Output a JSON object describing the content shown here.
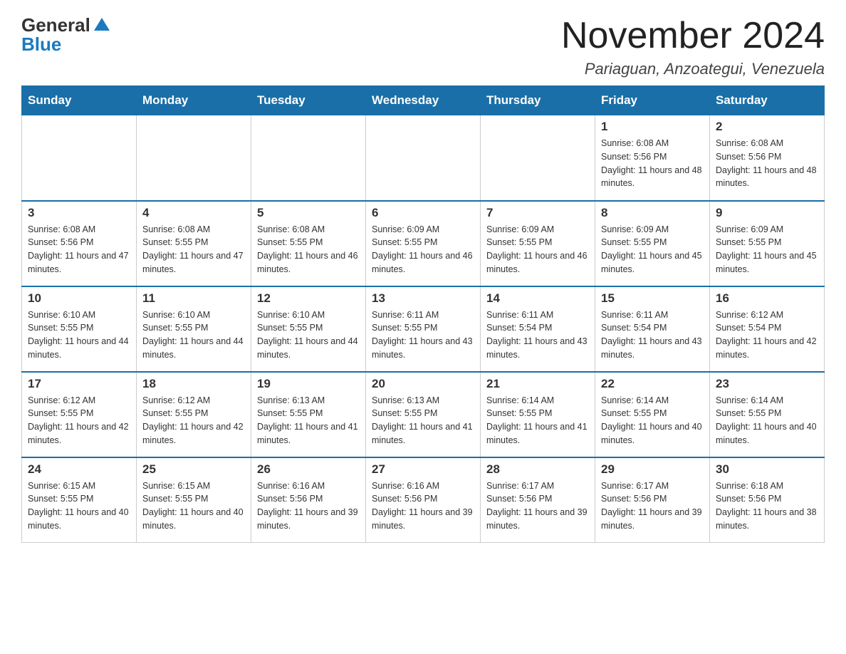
{
  "logo": {
    "general": "General",
    "blue": "Blue"
  },
  "title": "November 2024",
  "location": "Pariaguan, Anzoategui, Venezuela",
  "days_of_week": [
    "Sunday",
    "Monday",
    "Tuesday",
    "Wednesday",
    "Thursday",
    "Friday",
    "Saturday"
  ],
  "weeks": [
    [
      {
        "day": "",
        "info": ""
      },
      {
        "day": "",
        "info": ""
      },
      {
        "day": "",
        "info": ""
      },
      {
        "day": "",
        "info": ""
      },
      {
        "day": "",
        "info": ""
      },
      {
        "day": "1",
        "info": "Sunrise: 6:08 AM\nSunset: 5:56 PM\nDaylight: 11 hours and 48 minutes."
      },
      {
        "day": "2",
        "info": "Sunrise: 6:08 AM\nSunset: 5:56 PM\nDaylight: 11 hours and 48 minutes."
      }
    ],
    [
      {
        "day": "3",
        "info": "Sunrise: 6:08 AM\nSunset: 5:56 PM\nDaylight: 11 hours and 47 minutes."
      },
      {
        "day": "4",
        "info": "Sunrise: 6:08 AM\nSunset: 5:55 PM\nDaylight: 11 hours and 47 minutes."
      },
      {
        "day": "5",
        "info": "Sunrise: 6:08 AM\nSunset: 5:55 PM\nDaylight: 11 hours and 46 minutes."
      },
      {
        "day": "6",
        "info": "Sunrise: 6:09 AM\nSunset: 5:55 PM\nDaylight: 11 hours and 46 minutes."
      },
      {
        "day": "7",
        "info": "Sunrise: 6:09 AM\nSunset: 5:55 PM\nDaylight: 11 hours and 46 minutes."
      },
      {
        "day": "8",
        "info": "Sunrise: 6:09 AM\nSunset: 5:55 PM\nDaylight: 11 hours and 45 minutes."
      },
      {
        "day": "9",
        "info": "Sunrise: 6:09 AM\nSunset: 5:55 PM\nDaylight: 11 hours and 45 minutes."
      }
    ],
    [
      {
        "day": "10",
        "info": "Sunrise: 6:10 AM\nSunset: 5:55 PM\nDaylight: 11 hours and 44 minutes."
      },
      {
        "day": "11",
        "info": "Sunrise: 6:10 AM\nSunset: 5:55 PM\nDaylight: 11 hours and 44 minutes."
      },
      {
        "day": "12",
        "info": "Sunrise: 6:10 AM\nSunset: 5:55 PM\nDaylight: 11 hours and 44 minutes."
      },
      {
        "day": "13",
        "info": "Sunrise: 6:11 AM\nSunset: 5:55 PM\nDaylight: 11 hours and 43 minutes."
      },
      {
        "day": "14",
        "info": "Sunrise: 6:11 AM\nSunset: 5:54 PM\nDaylight: 11 hours and 43 minutes."
      },
      {
        "day": "15",
        "info": "Sunrise: 6:11 AM\nSunset: 5:54 PM\nDaylight: 11 hours and 43 minutes."
      },
      {
        "day": "16",
        "info": "Sunrise: 6:12 AM\nSunset: 5:54 PM\nDaylight: 11 hours and 42 minutes."
      }
    ],
    [
      {
        "day": "17",
        "info": "Sunrise: 6:12 AM\nSunset: 5:55 PM\nDaylight: 11 hours and 42 minutes."
      },
      {
        "day": "18",
        "info": "Sunrise: 6:12 AM\nSunset: 5:55 PM\nDaylight: 11 hours and 42 minutes."
      },
      {
        "day": "19",
        "info": "Sunrise: 6:13 AM\nSunset: 5:55 PM\nDaylight: 11 hours and 41 minutes."
      },
      {
        "day": "20",
        "info": "Sunrise: 6:13 AM\nSunset: 5:55 PM\nDaylight: 11 hours and 41 minutes."
      },
      {
        "day": "21",
        "info": "Sunrise: 6:14 AM\nSunset: 5:55 PM\nDaylight: 11 hours and 41 minutes."
      },
      {
        "day": "22",
        "info": "Sunrise: 6:14 AM\nSunset: 5:55 PM\nDaylight: 11 hours and 40 minutes."
      },
      {
        "day": "23",
        "info": "Sunrise: 6:14 AM\nSunset: 5:55 PM\nDaylight: 11 hours and 40 minutes."
      }
    ],
    [
      {
        "day": "24",
        "info": "Sunrise: 6:15 AM\nSunset: 5:55 PM\nDaylight: 11 hours and 40 minutes."
      },
      {
        "day": "25",
        "info": "Sunrise: 6:15 AM\nSunset: 5:55 PM\nDaylight: 11 hours and 40 minutes."
      },
      {
        "day": "26",
        "info": "Sunrise: 6:16 AM\nSunset: 5:56 PM\nDaylight: 11 hours and 39 minutes."
      },
      {
        "day": "27",
        "info": "Sunrise: 6:16 AM\nSunset: 5:56 PM\nDaylight: 11 hours and 39 minutes."
      },
      {
        "day": "28",
        "info": "Sunrise: 6:17 AM\nSunset: 5:56 PM\nDaylight: 11 hours and 39 minutes."
      },
      {
        "day": "29",
        "info": "Sunrise: 6:17 AM\nSunset: 5:56 PM\nDaylight: 11 hours and 39 minutes."
      },
      {
        "day": "30",
        "info": "Sunrise: 6:18 AM\nSunset: 5:56 PM\nDaylight: 11 hours and 38 minutes."
      }
    ]
  ]
}
